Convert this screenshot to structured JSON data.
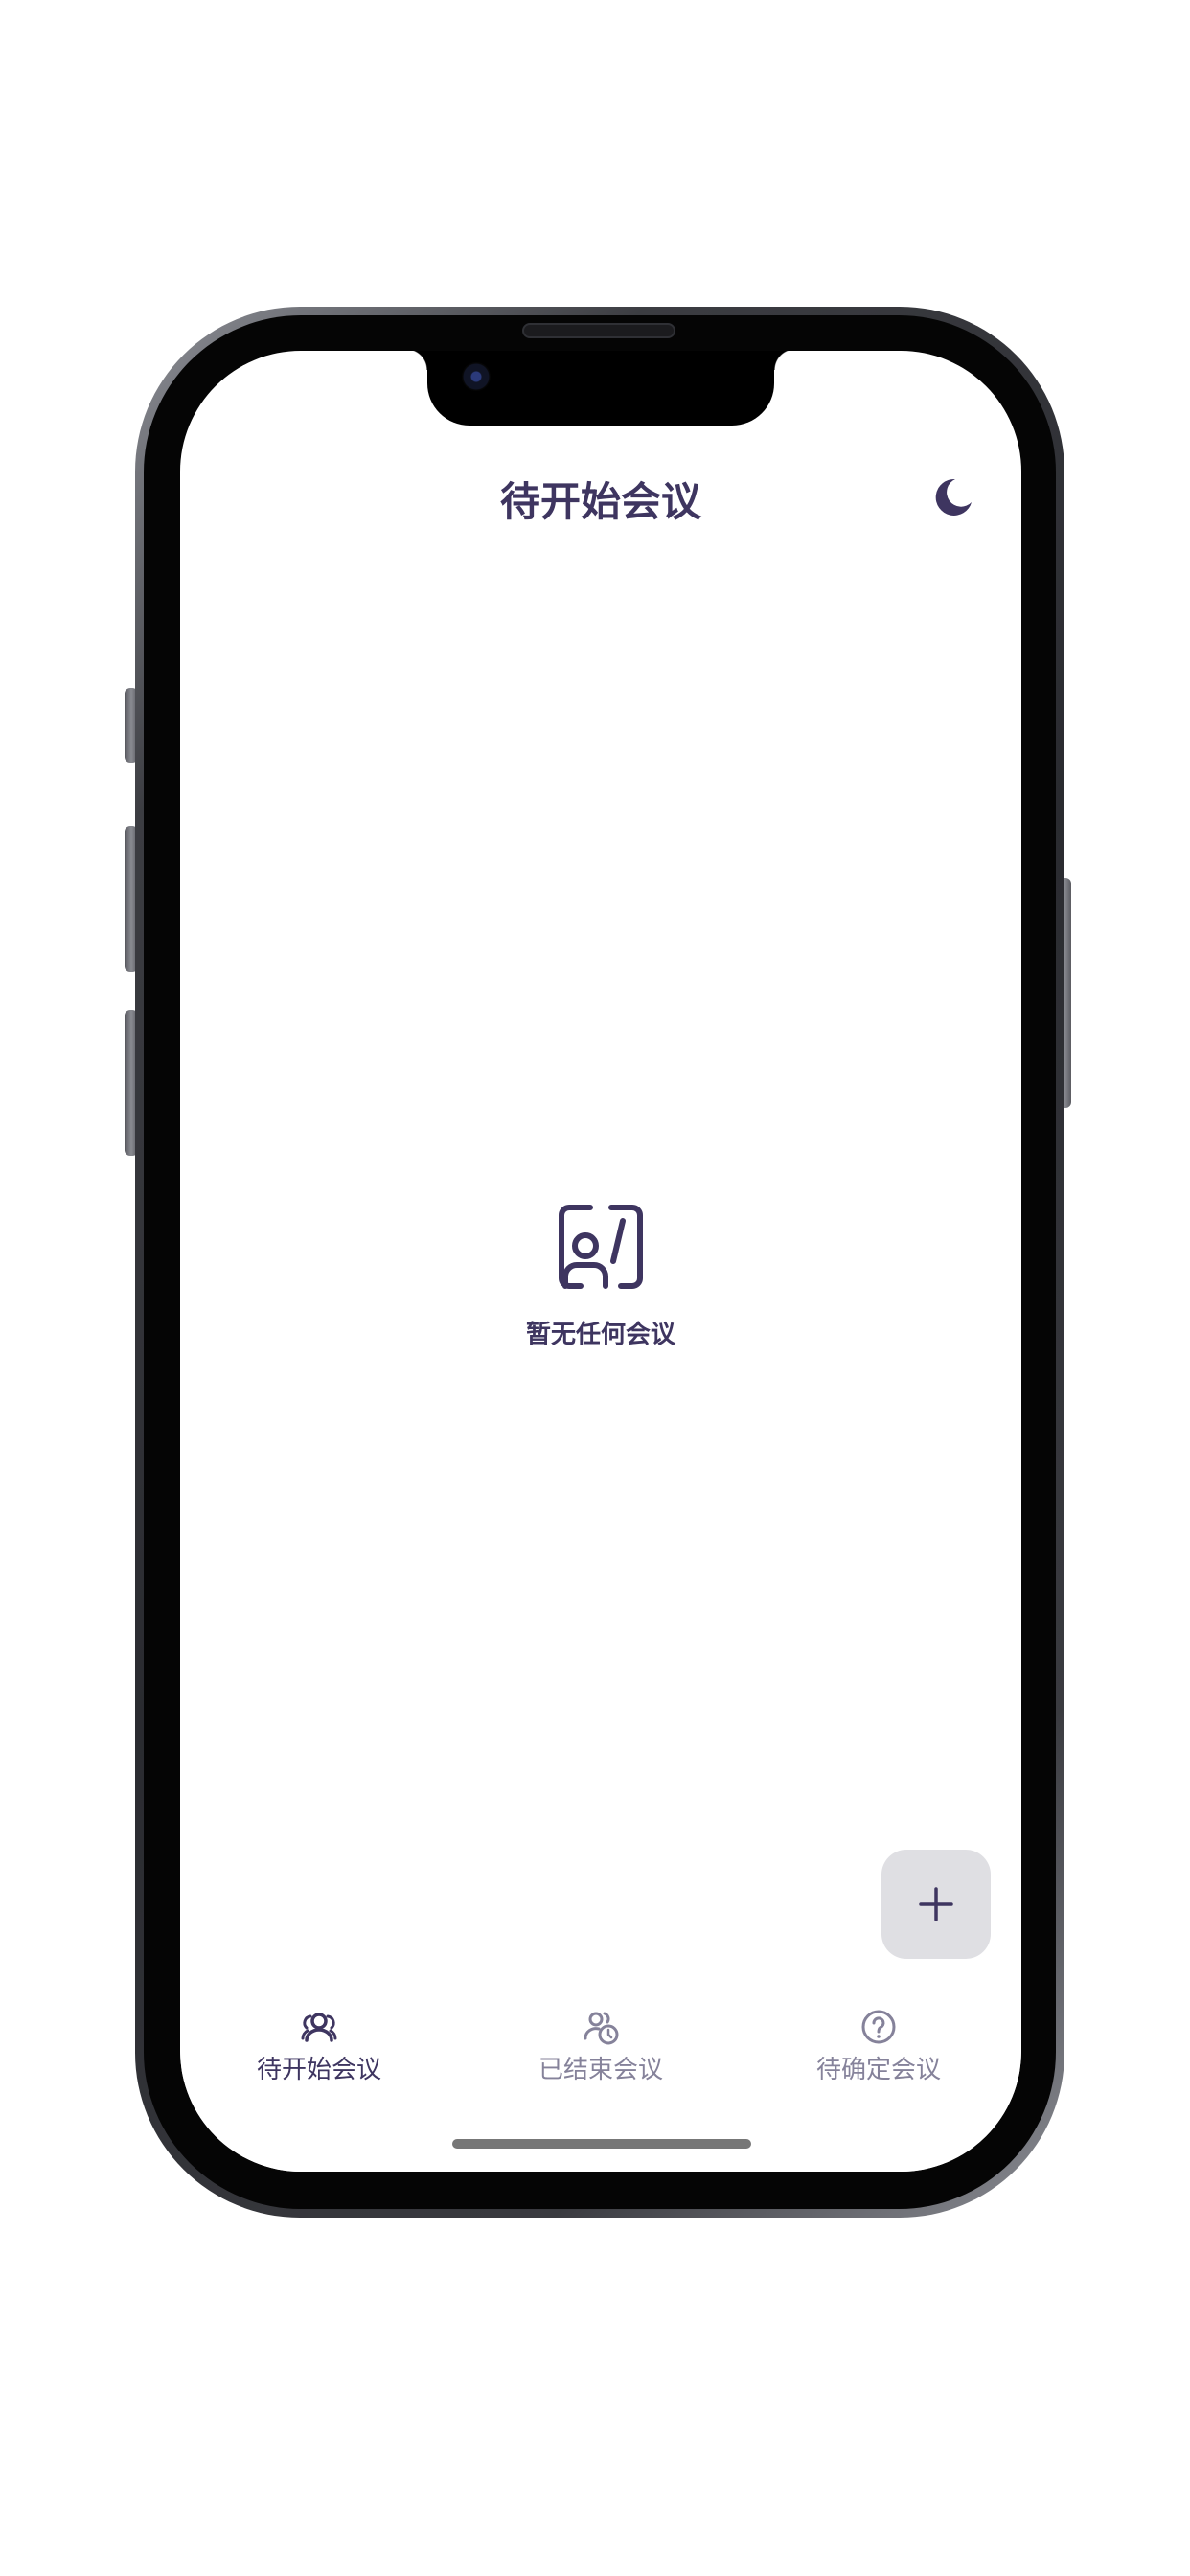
{
  "header": {
    "title": "待开始会议",
    "theme_toggle_icon": "moon-icon"
  },
  "empty_state": {
    "icon": "person-slash-icon",
    "message": "暂无任何会议"
  },
  "fab": {
    "label": "+",
    "icon": "plus-icon"
  },
  "tabbar": {
    "tabs": [
      {
        "label": "待开始会议",
        "icon": "group-icon",
        "active": true
      },
      {
        "label": "已结束会议",
        "icon": "group-clock-icon",
        "active": false
      },
      {
        "label": "待确定会议",
        "icon": "question-circle-icon",
        "active": false
      }
    ]
  },
  "colors": {
    "primary": "#3e3560",
    "inactive": "#85829a",
    "fab_background": "#dfdfe3",
    "background": "#ffffff"
  }
}
